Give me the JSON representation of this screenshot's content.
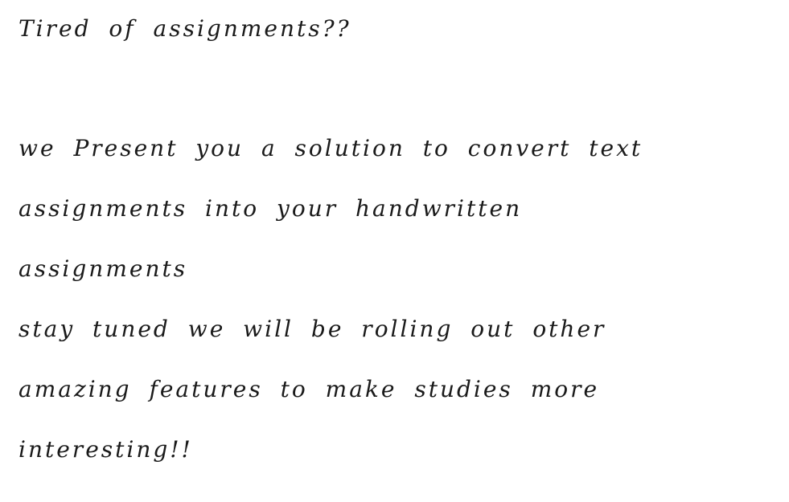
{
  "document": {
    "heading": "Tired of assignments??",
    "lines": [
      "we Present you a solution to convert text",
      "assignments into your handwritten",
      "assignments",
      "stay tuned we will be rolling out other",
      "amazing features to make studies more",
      "interesting!!"
    ]
  }
}
